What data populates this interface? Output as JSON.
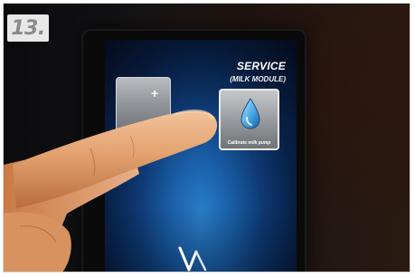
{
  "step": {
    "number": "13."
  },
  "screen": {
    "title": "SERVICE",
    "subtitle": "(MILK MODULE)",
    "tiles": [
      {
        "icon": "plus-icon",
        "symbol": "+"
      },
      {
        "icon": "water-drop-icon",
        "label": "Calibrate milk pump"
      }
    ]
  },
  "colors": {
    "screen_blue": "#1a5fa8",
    "tile_gray": "#9da1a5",
    "badge_bg": "#e8e8e8",
    "badge_text": "#8b8b8b",
    "drop_blue": "#4aa6e6",
    "skin": "#e3a16f"
  }
}
